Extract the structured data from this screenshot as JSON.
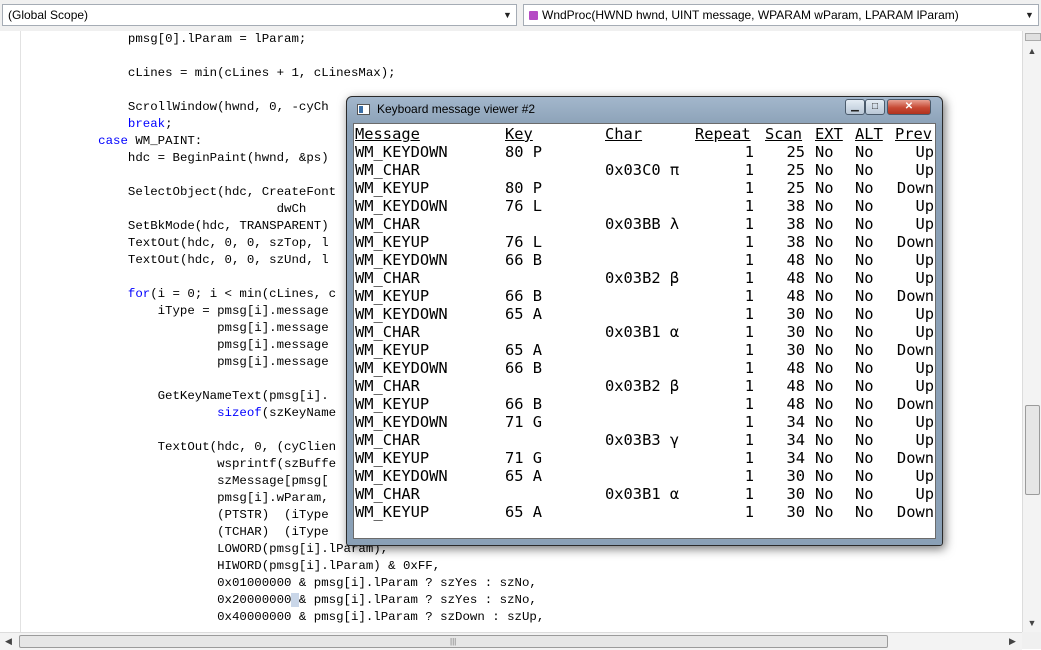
{
  "topbar": {
    "scope_combo": "(Global Scope)",
    "member_combo": "WndProc(HWND hwnd, UINT message, WPARAM wParam, LPARAM lParam)"
  },
  "code_lines": [
    {
      "indent": "        ",
      "parts": [
        {
          "t": "pmsg[0].lParam = lParam;"
        }
      ]
    },
    {
      "indent": "",
      "parts": []
    },
    {
      "indent": "        ",
      "parts": [
        {
          "t": "cLines = min(cLines + 1, cLinesMax);"
        }
      ]
    },
    {
      "indent": "",
      "parts": []
    },
    {
      "indent": "        ",
      "parts": [
        {
          "t": "ScrollWindow(hwnd, 0, -cyCh"
        }
      ]
    },
    {
      "indent": "        ",
      "parts": [
        {
          "t": "break",
          "k": 1
        },
        {
          "t": ";"
        }
      ]
    },
    {
      "indent": "    ",
      "parts": [
        {
          "t": "case",
          "k": 1
        },
        {
          "t": " WM_PAINT:"
        }
      ]
    },
    {
      "indent": "        ",
      "parts": [
        {
          "t": "hdc = BeginPaint(hwnd, &ps)"
        }
      ]
    },
    {
      "indent": "",
      "parts": []
    },
    {
      "indent": "        ",
      "parts": [
        {
          "t": "SelectObject(hdc, CreateFont"
        }
      ]
    },
    {
      "indent": "                            ",
      "parts": [
        {
          "t": "dwCh"
        }
      ]
    },
    {
      "indent": "        ",
      "parts": [
        {
          "t": "SetBkMode(hdc, TRANSPARENT)"
        }
      ]
    },
    {
      "indent": "        ",
      "parts": [
        {
          "t": "TextOut(hdc, 0, 0, szTop, l"
        }
      ]
    },
    {
      "indent": "        ",
      "parts": [
        {
          "t": "TextOut(hdc, 0, 0, szUnd, l"
        }
      ]
    },
    {
      "indent": "",
      "parts": []
    },
    {
      "indent": "        ",
      "parts": [
        {
          "t": "for",
          "k": 1
        },
        {
          "t": "(i = 0; i < min(cLines, c"
        }
      ]
    },
    {
      "indent": "            ",
      "parts": [
        {
          "t": "iType = pmsg[i].message"
        }
      ]
    },
    {
      "indent": "                    ",
      "parts": [
        {
          "t": "pmsg[i].message"
        }
      ]
    },
    {
      "indent": "                    ",
      "parts": [
        {
          "t": "pmsg[i].message"
        }
      ]
    },
    {
      "indent": "                    ",
      "parts": [
        {
          "t": "pmsg[i].message"
        }
      ]
    },
    {
      "indent": "",
      "parts": []
    },
    {
      "indent": "            ",
      "parts": [
        {
          "t": "GetKeyNameText(pmsg[i]."
        }
      ]
    },
    {
      "indent": "                    ",
      "parts": [
        {
          "t": "sizeof",
          "k": 1
        },
        {
          "t": "(szKeyName"
        }
      ]
    },
    {
      "indent": "",
      "parts": []
    },
    {
      "indent": "            ",
      "parts": [
        {
          "t": "TextOut(hdc, 0, (cyClien"
        }
      ]
    },
    {
      "indent": "                    ",
      "parts": [
        {
          "t": "wsprintf(szBuffe"
        }
      ]
    },
    {
      "indent": "                    ",
      "parts": [
        {
          "t": "szMessage[pmsg["
        }
      ]
    },
    {
      "indent": "                    ",
      "parts": [
        {
          "t": "pmsg[i].wParam,"
        }
      ]
    },
    {
      "indent": "                    ",
      "parts": [
        {
          "t": "(PTSTR)  (iType"
        }
      ]
    },
    {
      "indent": "                    ",
      "parts": [
        {
          "t": "(TCHAR)  (iType"
        }
      ]
    },
    {
      "indent": "                    ",
      "parts": [
        {
          "t": "LOWORD(pmsg[i].lParam),"
        }
      ]
    },
    {
      "indent": "                    ",
      "parts": [
        {
          "t": "HIWORD(pmsg[i].lParam) & 0xFF,"
        }
      ]
    },
    {
      "indent": "                    ",
      "parts": [
        {
          "t": "0x01000000 & pmsg[i].lParam ? szYes : szNo,"
        }
      ]
    },
    {
      "indent": "                    ",
      "parts": [
        {
          "t": "0x20000000"
        },
        {
          "t": " ",
          "s": 1
        },
        {
          "t": "& pmsg[i].lParam ? szYes : szNo,"
        }
      ]
    },
    {
      "indent": "                    ",
      "parts": [
        {
          "t": "0x40000000 & pmsg[i].lParam ? szDown : szUp,"
        }
      ]
    }
  ],
  "viewer": {
    "title": "Keyboard message viewer #2",
    "headers": {
      "message": "Message",
      "key": "Key",
      "char": "Char",
      "repeat": "Repeat",
      "scan": "Scan",
      "ext": "EXT",
      "alt": "ALT",
      "prev": "Prev"
    },
    "rows": [
      {
        "message": "WM_KEYDOWN",
        "key": "80 P",
        "char": "",
        "repeat": "1",
        "scan": "25",
        "ext": "No",
        "alt": "No",
        "prev": "Up"
      },
      {
        "message": "WM_CHAR",
        "key": "",
        "char": "0x03C0 π",
        "repeat": "1",
        "scan": "25",
        "ext": "No",
        "alt": "No",
        "prev": "Up"
      },
      {
        "message": "WM_KEYUP",
        "key": "80 P",
        "char": "",
        "repeat": "1",
        "scan": "25",
        "ext": "No",
        "alt": "No",
        "prev": "Down"
      },
      {
        "message": "WM_KEYDOWN",
        "key": "76 L",
        "char": "",
        "repeat": "1",
        "scan": "38",
        "ext": "No",
        "alt": "No",
        "prev": "Up"
      },
      {
        "message": "WM_CHAR",
        "key": "",
        "char": "0x03BB λ",
        "repeat": "1",
        "scan": "38",
        "ext": "No",
        "alt": "No",
        "prev": "Up"
      },
      {
        "message": "WM_KEYUP",
        "key": "76 L",
        "char": "",
        "repeat": "1",
        "scan": "38",
        "ext": "No",
        "alt": "No",
        "prev": "Down"
      },
      {
        "message": "WM_KEYDOWN",
        "key": "66 B",
        "char": "",
        "repeat": "1",
        "scan": "48",
        "ext": "No",
        "alt": "No",
        "prev": "Up"
      },
      {
        "message": "WM_CHAR",
        "key": "",
        "char": "0x03B2 β",
        "repeat": "1",
        "scan": "48",
        "ext": "No",
        "alt": "No",
        "prev": "Up"
      },
      {
        "message": "WM_KEYUP",
        "key": "66 B",
        "char": "",
        "repeat": "1",
        "scan": "48",
        "ext": "No",
        "alt": "No",
        "prev": "Down"
      },
      {
        "message": "WM_KEYDOWN",
        "key": "65 A",
        "char": "",
        "repeat": "1",
        "scan": "30",
        "ext": "No",
        "alt": "No",
        "prev": "Up"
      },
      {
        "message": "WM_CHAR",
        "key": "",
        "char": "0x03B1 α",
        "repeat": "1",
        "scan": "30",
        "ext": "No",
        "alt": "No",
        "prev": "Up"
      },
      {
        "message": "WM_KEYUP",
        "key": "65 A",
        "char": "",
        "repeat": "1",
        "scan": "30",
        "ext": "No",
        "alt": "No",
        "prev": "Down"
      },
      {
        "message": "WM_KEYDOWN",
        "key": "66 B",
        "char": "",
        "repeat": "1",
        "scan": "48",
        "ext": "No",
        "alt": "No",
        "prev": "Up"
      },
      {
        "message": "WM_CHAR",
        "key": "",
        "char": "0x03B2 β",
        "repeat": "1",
        "scan": "48",
        "ext": "No",
        "alt": "No",
        "prev": "Up"
      },
      {
        "message": "WM_KEYUP",
        "key": "66 B",
        "char": "",
        "repeat": "1",
        "scan": "48",
        "ext": "No",
        "alt": "No",
        "prev": "Down"
      },
      {
        "message": "WM_KEYDOWN",
        "key": "71 G",
        "char": "",
        "repeat": "1",
        "scan": "34",
        "ext": "No",
        "alt": "No",
        "prev": "Up"
      },
      {
        "message": "WM_CHAR",
        "key": "",
        "char": "0x03B3 γ",
        "repeat": "1",
        "scan": "34",
        "ext": "No",
        "alt": "No",
        "prev": "Up"
      },
      {
        "message": "WM_KEYUP",
        "key": "71 G",
        "char": "",
        "repeat": "1",
        "scan": "34",
        "ext": "No",
        "alt": "No",
        "prev": "Down"
      },
      {
        "message": "WM_KEYDOWN",
        "key": "65 A",
        "char": "",
        "repeat": "1",
        "scan": "30",
        "ext": "No",
        "alt": "No",
        "prev": "Up"
      },
      {
        "message": "WM_CHAR",
        "key": "",
        "char": "0x03B1 α",
        "repeat": "1",
        "scan": "30",
        "ext": "No",
        "alt": "No",
        "prev": "Up"
      },
      {
        "message": "WM_KEYUP",
        "key": "65 A",
        "char": "",
        "repeat": "1",
        "scan": "30",
        "ext": "No",
        "alt": "No",
        "prev": "Down"
      }
    ]
  },
  "colors": {
    "keyword": "#0000ff",
    "title_bar": "#8aa0b6",
    "close_button": "#c74934"
  },
  "icons": {
    "combo_arrow": "chevron-down-icon",
    "member_icon": "method-icon",
    "window_icon": "app-window-icon",
    "minimize": "minimize-icon",
    "maximize": "maximize-icon",
    "close": "close-icon"
  }
}
